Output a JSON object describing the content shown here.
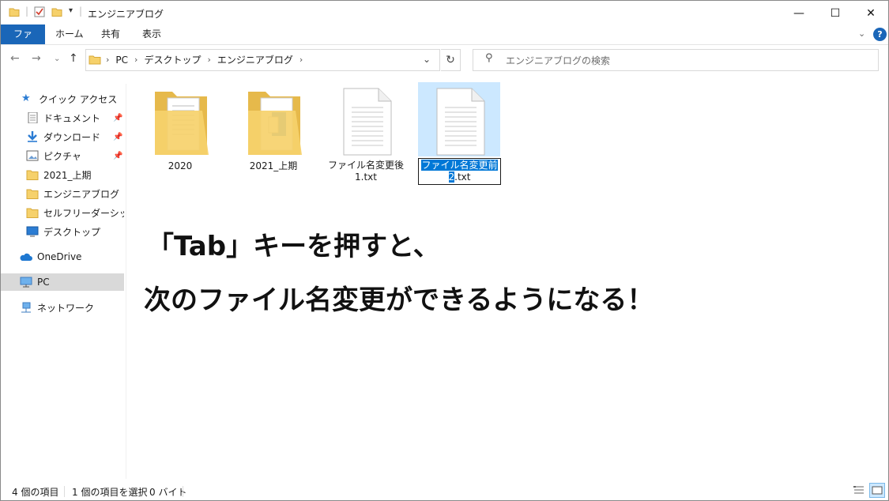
{
  "window": {
    "title": "エンジニアブログ"
  },
  "ribbon": {
    "tabs": [
      "ファイル",
      "ホーム",
      "共有",
      "表示"
    ]
  },
  "address": {
    "crumbs": [
      "PC",
      "デスクトップ",
      "エンジニアブログ"
    ]
  },
  "search": {
    "placeholder": "エンジニアブログの検索"
  },
  "sidebar": {
    "items": [
      {
        "label": "クイック アクセス",
        "icon": "star-icon"
      },
      {
        "label": "ドキュメント",
        "icon": "document-icon",
        "pinned": true
      },
      {
        "label": "ダウンロード",
        "icon": "download-icon",
        "pinned": true
      },
      {
        "label": "ピクチャ",
        "icon": "picture-icon",
        "pinned": true
      },
      {
        "label": "2021_上期",
        "icon": "folder-icon"
      },
      {
        "label": "エンジニアブログ",
        "icon": "folder-icon"
      },
      {
        "label": "セルフリーダーシップ研修",
        "icon": "folder-icon"
      },
      {
        "label": "デスクトップ",
        "icon": "desktop-icon"
      },
      {
        "label": "OneDrive",
        "icon": "cloud-icon"
      },
      {
        "label": "PC",
        "icon": "pc-icon",
        "selected": true
      },
      {
        "label": "ネットワーク",
        "icon": "network-icon"
      }
    ]
  },
  "files": [
    {
      "name": "2020",
      "type": "folder"
    },
    {
      "name": "2021_上期",
      "type": "folder"
    },
    {
      "name_line1": "ファイル名変更後",
      "name_line2": "1.txt",
      "type": "text"
    },
    {
      "name_sel": "ファイル名変更前",
      "name_cursor": "2",
      "name_rest": ".txt",
      "type": "text",
      "renaming": true
    }
  ],
  "annotation": {
    "line1": "「Tab」キーを押すと、",
    "line2": "次のファイル名変更ができるようになる！"
  },
  "status": {
    "count": "4 個の項目",
    "selected": "1 個の項目を選択",
    "size": "0 バイト"
  },
  "colors": {
    "accent": "#1a66b8",
    "selection": "#cce8ff",
    "highlight": "#0078d7",
    "folder": "#f6d16b"
  }
}
